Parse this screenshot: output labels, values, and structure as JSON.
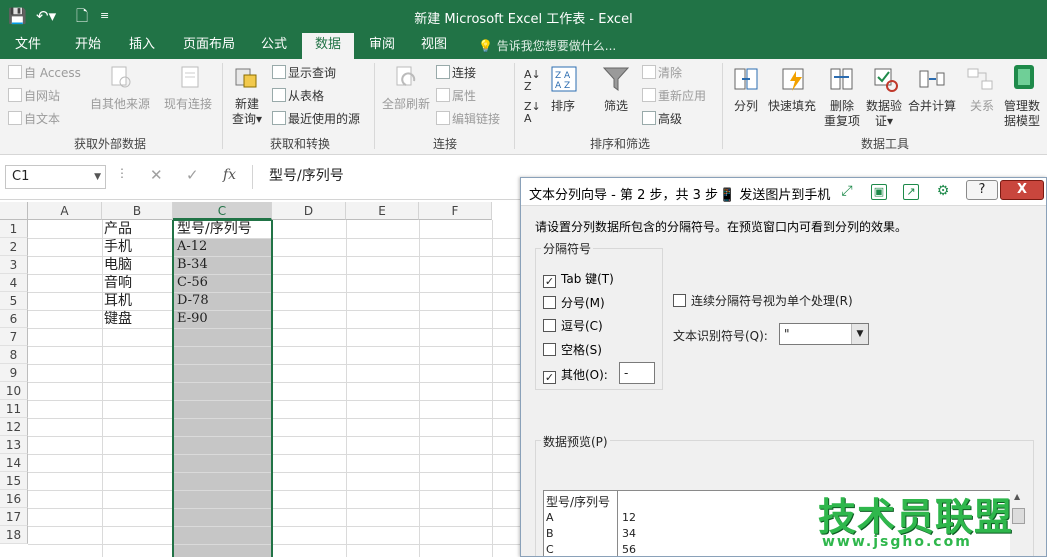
{
  "titlebar": {
    "title": "新建 Microsoft Excel 工作表 - Excel",
    "save_icon": "save-icon",
    "undo_icon": "undo-icon",
    "new_icon": "new-document-icon"
  },
  "ribbon_tabs": {
    "items": [
      "文件",
      "开始",
      "插入",
      "页面布局",
      "公式",
      "数据",
      "审阅",
      "视图"
    ],
    "active": "数据",
    "tell_me": "告诉我您想要做什么..."
  },
  "ribbon": {
    "get_external": {
      "from_access": "自 Access",
      "from_web": "自网站",
      "from_text": "自文本",
      "other_sources": "自其他来源",
      "existing_connections": "现有连接",
      "label": "获取外部数据"
    },
    "get_transform": {
      "new_query": "新建",
      "new_query_2": "查询",
      "show_queries": "显示查询",
      "from_table": "从表格",
      "recent_sources": "最近使用的源",
      "label": "获取和转换"
    },
    "connections": {
      "refresh_all": "全部刷新",
      "connections": "连接",
      "properties": "属性",
      "edit_links": "编辑链接",
      "label": "连接"
    },
    "sort_filter": {
      "sort": "排序",
      "filter": "筛选",
      "clear": "清除",
      "reapply": "重新应用",
      "advanced": "高级",
      "label": "排序和筛选"
    },
    "data_tools": {
      "text_to_columns": "分列",
      "flash_fill": "快速填充",
      "remove_dup_1": "删除",
      "remove_dup_2": "重复项",
      "validation_1": "数据验",
      "validation_2": "证",
      "consolidate": "合并计算",
      "relationships": "关系",
      "data_model_1": "管理数",
      "data_model_2": "据模型",
      "label": "数据工具"
    }
  },
  "formula_bar": {
    "name_box": "C1",
    "content": "型号/序列号",
    "fx": "fx",
    "cancel": "✕",
    "enter": "✓"
  },
  "grid": {
    "columns": [
      "A",
      "B",
      "C",
      "D",
      "E",
      "F"
    ],
    "rows": [
      "1",
      "2",
      "3",
      "4",
      "5",
      "6",
      "7",
      "8",
      "9",
      "10",
      "11",
      "12",
      "13",
      "14",
      "15",
      "16",
      "17",
      "18"
    ],
    "col_b": [
      "产品",
      "手机",
      "电脑",
      "音响",
      "耳机",
      "键盘"
    ],
    "col_c": [
      "型号/序列号",
      "A-12",
      "B-34",
      "C-56",
      "D-78",
      "E-90"
    ]
  },
  "dialog": {
    "title": "文本分列向导 - 第 2 步，共 3 步",
    "send_to_phone": "发送图片到手机",
    "help": "?",
    "close": "X",
    "description": "请设置分列数据所包含的分隔符号。在预览窗口内可看到分列的效果。",
    "delimiters_label": "分隔符号",
    "delimiters": [
      {
        "label": "Tab 键(T)",
        "checked": true
      },
      {
        "label": "分号(M)",
        "checked": false
      },
      {
        "label": "逗号(C)",
        "checked": false
      },
      {
        "label": "空格(S)",
        "checked": false
      },
      {
        "label": "其他(O):",
        "checked": true
      }
    ],
    "other_value": "-",
    "consecutive_label": "连续分隔符号视为单个处理(R)",
    "text_qualifier_label": "文本识别符号(Q):",
    "text_qualifier_value": "\"",
    "preview_label": "数据预览(P)",
    "preview_rows": [
      [
        "型号/序列号",
        ""
      ],
      [
        "A",
        "12"
      ],
      [
        "B",
        "34"
      ],
      [
        "C",
        "56"
      ]
    ]
  },
  "watermark": {
    "name": "技术员联盟",
    "url": "www.jsgho.com"
  }
}
